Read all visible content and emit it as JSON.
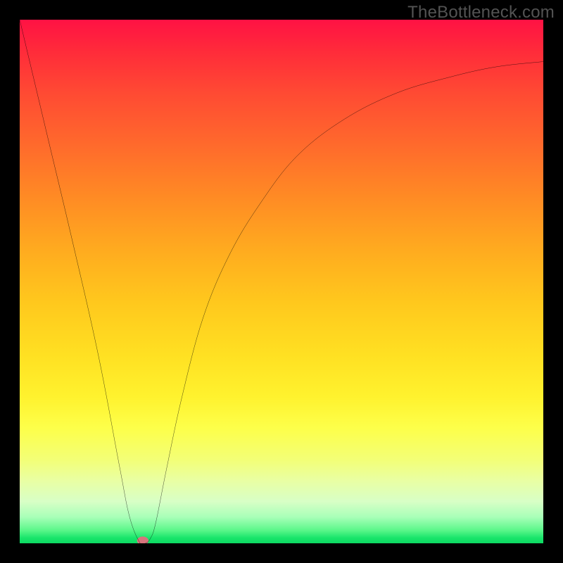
{
  "watermark": "TheBottleneck.com",
  "chart_data": {
    "type": "line",
    "title": "",
    "xlabel": "",
    "ylabel": "",
    "xlim": [
      0,
      100
    ],
    "ylim": [
      0,
      100
    ],
    "grid": false,
    "series": [
      {
        "name": "bottleneck-curve",
        "x": [
          0,
          5,
          10,
          15,
          19,
          21,
          23,
          24,
          25,
          26,
          28,
          31,
          35,
          40,
          46,
          53,
          62,
          72,
          82,
          91,
          100
        ],
        "y": [
          100,
          79,
          58,
          36,
          15,
          5,
          0,
          0,
          1,
          4,
          14,
          28,
          43,
          55,
          65,
          74,
          81,
          86,
          89,
          91,
          92
        ]
      }
    ],
    "marker": {
      "x": 23.5,
      "y": 0.5,
      "color": "#d7747c"
    },
    "background_gradient": "red-orange-yellow-green vertical"
  }
}
